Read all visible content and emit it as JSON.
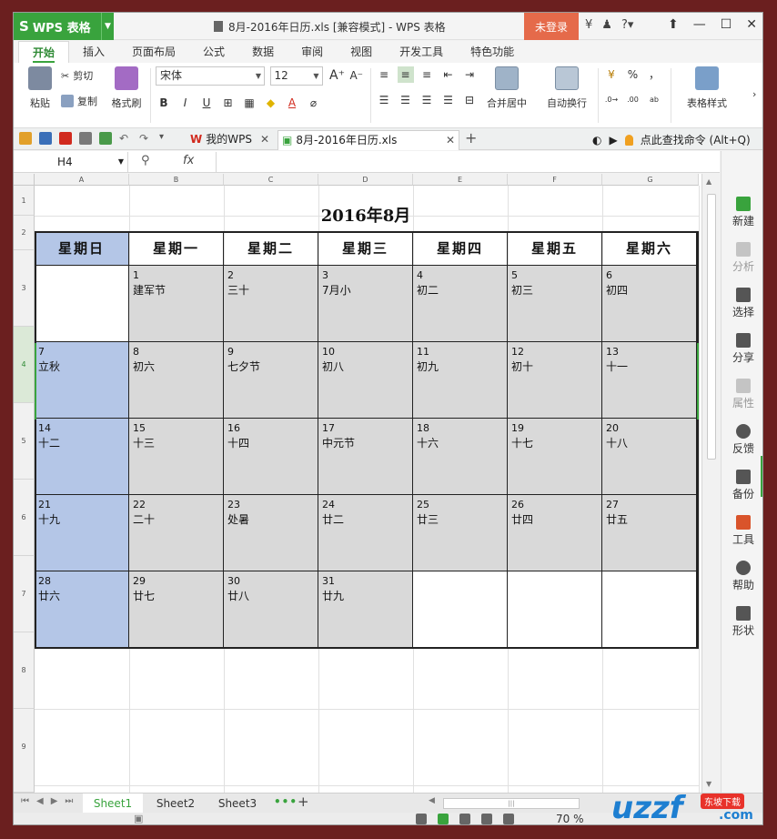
{
  "app": {
    "name": "WPS 表格",
    "window_title": "8月-2016年日历.xls [兼容模式] - WPS 表格",
    "login_label": "未登录"
  },
  "ribbon": {
    "tabs": [
      "开始",
      "插入",
      "页面布局",
      "公式",
      "数据",
      "审阅",
      "视图",
      "开发工具",
      "特色功能"
    ],
    "paste_label": "粘贴",
    "cut_label": "剪切",
    "copy_label": "复制",
    "format_painter_label": "格式刷",
    "font_name": "宋体",
    "font_size": "12",
    "merge_center_label": "合并居中",
    "wrap_text_label": "自动换行",
    "table_style_label": "表格样式",
    "percent": "%",
    "comma": "，"
  },
  "doc_tabs": {
    "home_label": "我的WPS",
    "file_label": "8月-2016年日历.xls",
    "search_command": "点此查找命令 (Alt+Q)"
  },
  "formula": {
    "cell_ref": "H4",
    "fx": "fx",
    "value": ""
  },
  "grid": {
    "columns": [
      "A",
      "B",
      "C",
      "D",
      "E",
      "F",
      "G"
    ],
    "rows": [
      "1",
      "2",
      "3",
      "4",
      "5",
      "6",
      "7",
      "8",
      "9"
    ]
  },
  "calendar": {
    "title": "2016年8月",
    "weekdays": [
      "星期日",
      "星期一",
      "星期二",
      "星期三",
      "星期四",
      "星期五",
      "星期六"
    ],
    "weeks": [
      [
        {
          "d": "",
          "l": ""
        },
        {
          "d": "1",
          "l": "建军节"
        },
        {
          "d": "2",
          "l": "三十"
        },
        {
          "d": "3",
          "l": "7月小"
        },
        {
          "d": "4",
          "l": "初二"
        },
        {
          "d": "5",
          "l": "初三"
        },
        {
          "d": "6",
          "l": "初四"
        }
      ],
      [
        {
          "d": "7",
          "l": "立秋"
        },
        {
          "d": "8",
          "l": "初六"
        },
        {
          "d": "9",
          "l": "七夕节"
        },
        {
          "d": "10",
          "l": "初八"
        },
        {
          "d": "11",
          "l": "初九"
        },
        {
          "d": "12",
          "l": "初十"
        },
        {
          "d": "13",
          "l": "十一"
        }
      ],
      [
        {
          "d": "14",
          "l": "十二"
        },
        {
          "d": "15",
          "l": "十三"
        },
        {
          "d": "16",
          "l": "十四"
        },
        {
          "d": "17",
          "l": "中元节"
        },
        {
          "d": "18",
          "l": "十六"
        },
        {
          "d": "19",
          "l": "十七"
        },
        {
          "d": "20",
          "l": "十八"
        }
      ],
      [
        {
          "d": "21",
          "l": "十九"
        },
        {
          "d": "22",
          "l": "二十"
        },
        {
          "d": "23",
          "l": "处暑"
        },
        {
          "d": "24",
          "l": "廿二"
        },
        {
          "d": "25",
          "l": "廿三"
        },
        {
          "d": "26",
          "l": "廿四"
        },
        {
          "d": "27",
          "l": "廿五"
        }
      ],
      [
        {
          "d": "28",
          "l": "廿六"
        },
        {
          "d": "29",
          "l": "廿七"
        },
        {
          "d": "30",
          "l": "廿八"
        },
        {
          "d": "31",
          "l": "廿九"
        },
        {
          "d": "",
          "l": ""
        },
        {
          "d": "",
          "l": ""
        },
        {
          "d": "",
          "l": ""
        }
      ]
    ]
  },
  "task_pane": [
    "新建",
    "分析",
    "选择",
    "分享",
    "属性",
    "反馈",
    "备份",
    "工具",
    "帮助",
    "形状"
  ],
  "sheets": [
    "Sheet1",
    "Sheet2",
    "Sheet3"
  ],
  "status": {
    "zoom": "70 %"
  },
  "watermark": {
    "text": "uzzf",
    "badge": "东坡下载",
    "domain": ".com"
  },
  "colors": {
    "accent": "#39a33d",
    "sunday": "#b4c6e7",
    "weekday": "#d9d9d9",
    "login": "#e56a4a"
  }
}
